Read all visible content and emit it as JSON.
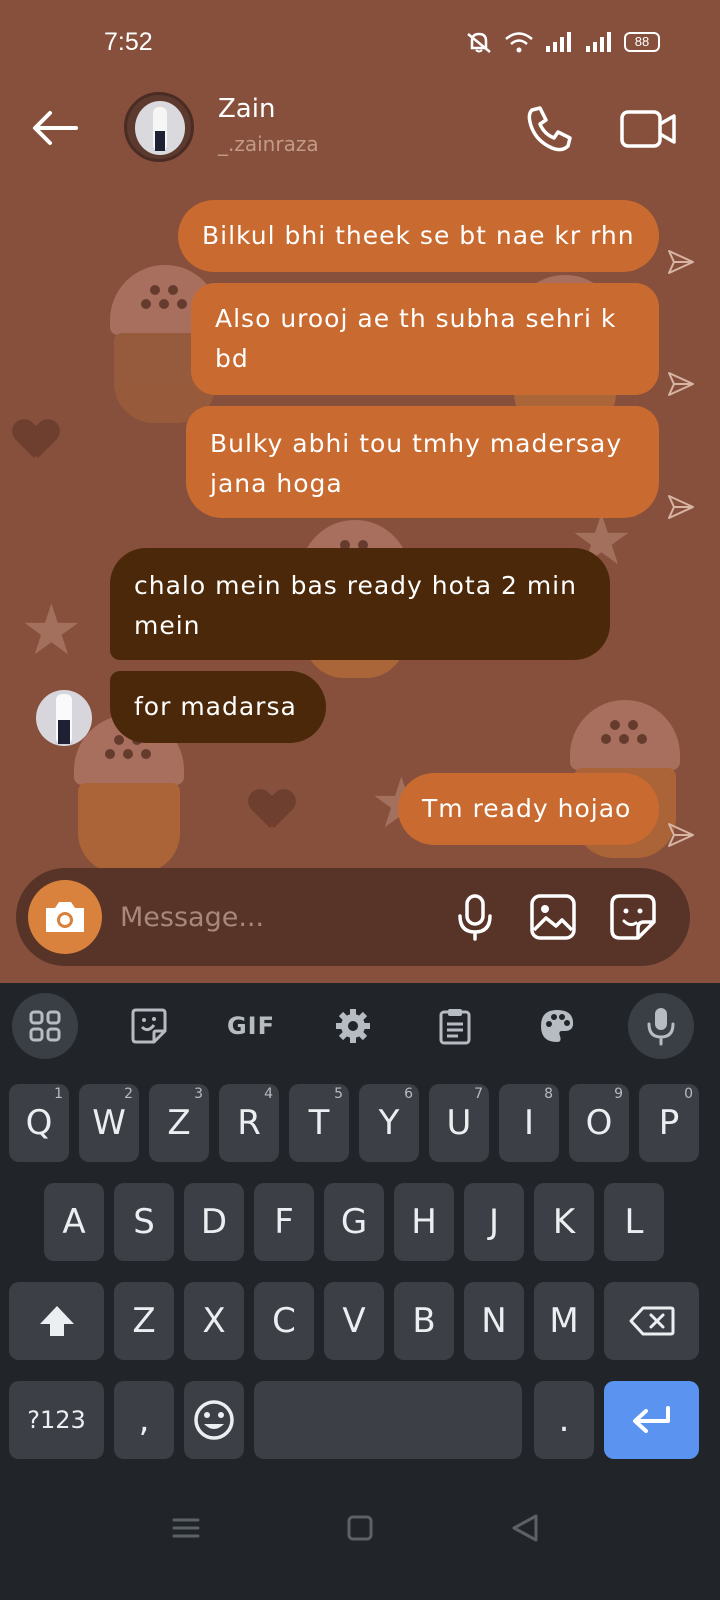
{
  "status_bar": {
    "time": "7:52",
    "battery": "88",
    "icons": [
      "mute-icon",
      "wifi-icon",
      "signal-icon",
      "signal-icon",
      "battery-icon"
    ]
  },
  "header": {
    "contact_name": "Zain",
    "contact_handle": "_.zainraza",
    "back_icon": "arrow-left-icon",
    "call_icon": "phone-icon",
    "video_icon": "video-camera-icon"
  },
  "messages": [
    {
      "direction": "out",
      "text": "Bilkul bhi theek se bt nae kr rhn",
      "status_icon": "sent-icon"
    },
    {
      "direction": "out",
      "lines": [
        "Also urooj ae th subha sehri k",
        "bd"
      ],
      "status_icon": "sent-icon"
    },
    {
      "direction": "out",
      "lines": [
        "Bulky abhi tou tmhy madersay",
        "jana hoga"
      ],
      "status_icon": "sent-icon"
    },
    {
      "direction": "in",
      "lines": [
        "chalo mein bas ready hota 2 min",
        "mein"
      ]
    },
    {
      "direction": "in",
      "text": "for madarsa"
    },
    {
      "direction": "out",
      "text": "Tm ready hojao",
      "status_icon": "sent-icon"
    }
  ],
  "composer": {
    "placeholder": "Message...",
    "icons": [
      "camera-icon",
      "microphone-icon",
      "image-icon",
      "sticker-icon"
    ]
  },
  "keyboard": {
    "toolbar": {
      "gif_label": "GIF",
      "icons": [
        "apps-grid-icon",
        "sticker-icon",
        "gif-icon",
        "settings-gear-icon",
        "clipboard-icon",
        "palette-icon",
        "microphone-icon"
      ]
    },
    "row1": [
      {
        "label": "Q",
        "hint": "1"
      },
      {
        "label": "W",
        "hint": "2"
      },
      {
        "label": "Z",
        "hint": "3"
      },
      {
        "label": "R",
        "hint": "4"
      },
      {
        "label": "T",
        "hint": "5"
      },
      {
        "label": "Y",
        "hint": "6"
      },
      {
        "label": "U",
        "hint": "7"
      },
      {
        "label": "I",
        "hint": "8"
      },
      {
        "label": "O",
        "hint": "9"
      },
      {
        "label": "P",
        "hint": "0"
      }
    ],
    "row2": [
      "A",
      "S",
      "D",
      "F",
      "G",
      "H",
      "J",
      "K",
      "L"
    ],
    "row3": [
      "Z",
      "X",
      "C",
      "V",
      "B",
      "N",
      "M"
    ],
    "row4": {
      "symbols": "?123",
      "comma": ",",
      "period": ".",
      "emoji_icon": "emoji-icon",
      "enter_icon": "enter-icon"
    },
    "shift_icon": "shift-arrow-icon",
    "backspace_icon": "backspace-icon"
  },
  "navbar": {
    "icons": [
      "menu-icon",
      "home-square-icon",
      "back-triangle-icon"
    ]
  }
}
